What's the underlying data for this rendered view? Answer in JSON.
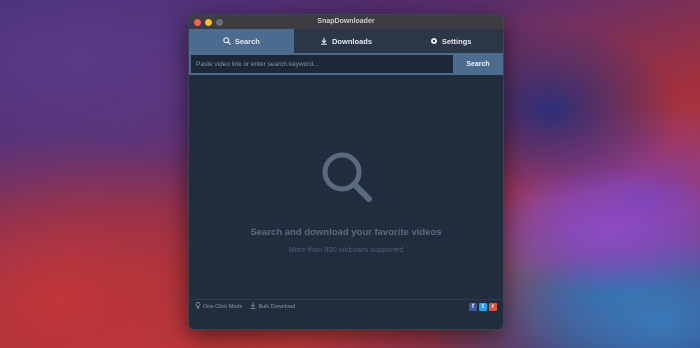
{
  "window": {
    "title": "SnapDownloader"
  },
  "tabs": [
    {
      "label": "Search",
      "icon": "search-icon",
      "active": true
    },
    {
      "label": "Downloads",
      "icon": "download-icon",
      "active": false
    },
    {
      "label": "Settings",
      "icon": "gear-icon",
      "active": false
    }
  ],
  "search": {
    "placeholder": "Paste video link or enter search keyword...",
    "value": "",
    "button_label": "Search"
  },
  "empty_state": {
    "icon": "magnifier-icon",
    "heading": "Search and download your favorite videos",
    "subheading": "More than 900 websites supported"
  },
  "footer": {
    "one_click_label": "One-Click Mode",
    "bulk_label": "Bulk Download",
    "social": [
      {
        "name": "facebook-icon",
        "glyph": "f",
        "color": "#3b5998"
      },
      {
        "name": "twitter-icon",
        "glyph": "t",
        "color": "#1da1f2"
      },
      {
        "name": "reddit-icon",
        "glyph": "r",
        "color": "#e0503a"
      }
    ]
  },
  "colors": {
    "window_bg": "#212c3c",
    "accent": "#4d6b8f",
    "tabbar_bg": "#2b3747"
  }
}
